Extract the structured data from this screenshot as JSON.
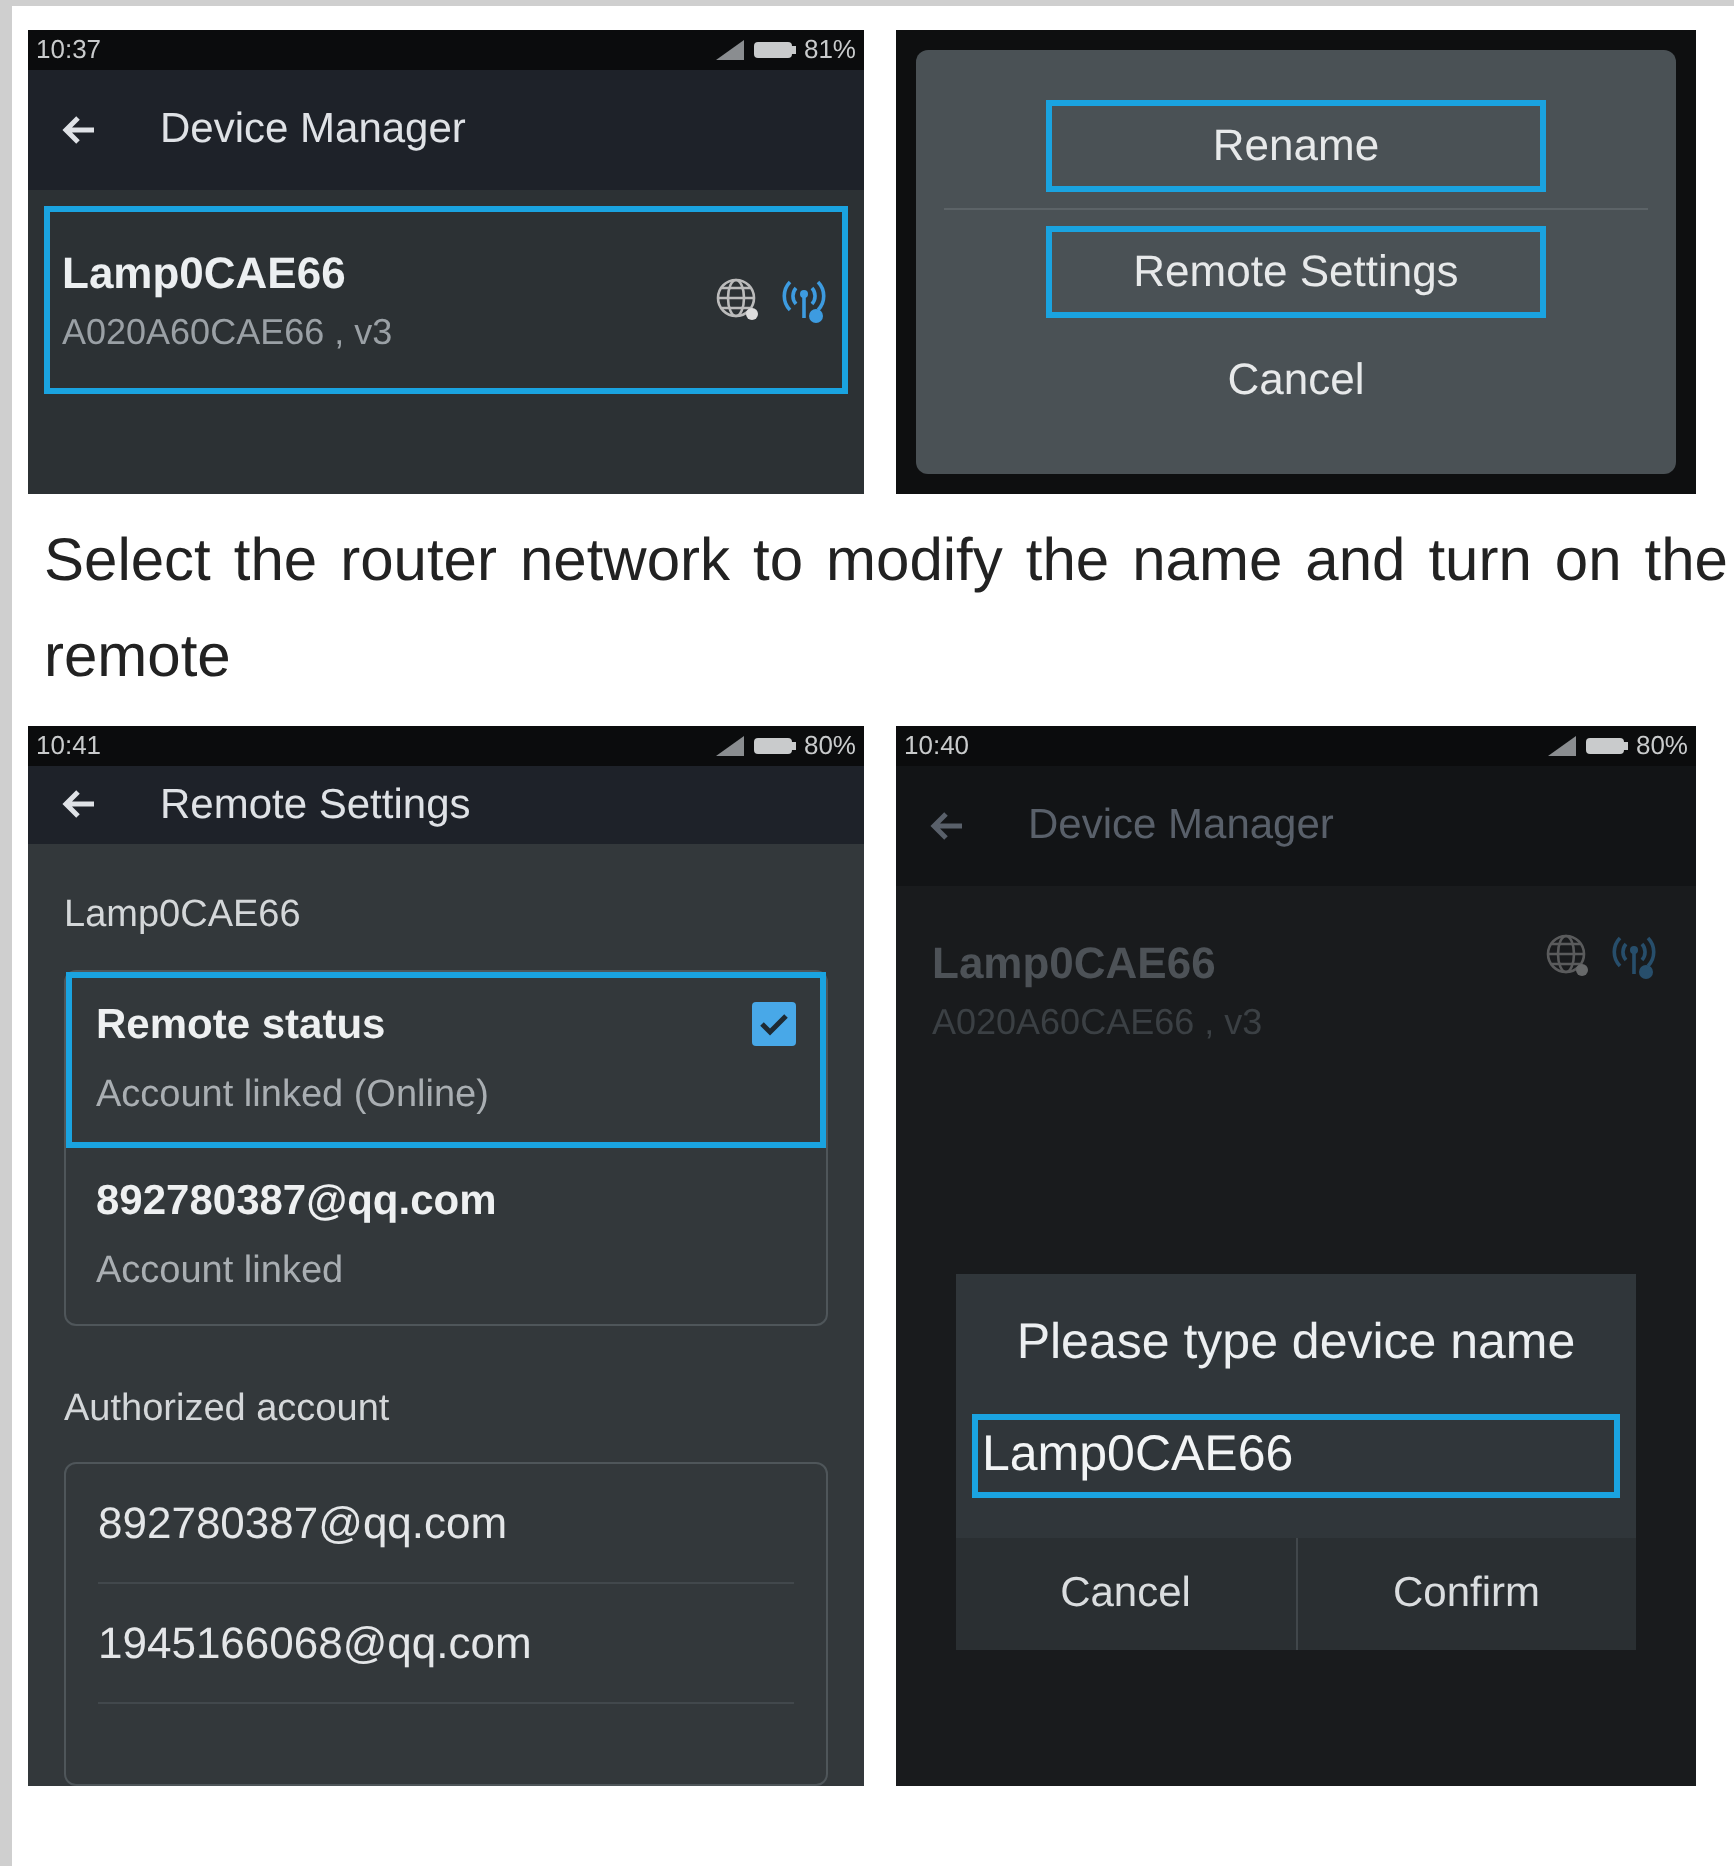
{
  "device_list_screen": {
    "status_bar": {
      "time": "10:37",
      "battery": "81%"
    },
    "header": {
      "title": "Device Manager"
    },
    "devices": [
      {
        "name": "Lamp0CAE66",
        "detail": "A020A60CAE66 , v3",
        "highlighted": true
      }
    ]
  },
  "action_menu": {
    "options": [
      {
        "label": "Rename",
        "highlighted": true
      },
      {
        "label": "Remote Settings",
        "highlighted": true
      },
      {
        "label": "Cancel",
        "highlighted": false
      }
    ]
  },
  "caption": "Select the router network to modify the name and turn on the remote",
  "remote_settings_screen": {
    "status_bar": {
      "time": "10:41",
      "battery": "80%"
    },
    "header": {
      "title": "Remote Settings"
    },
    "device_label": "Lamp0CAE66",
    "status_rows": [
      {
        "title": "Remote status",
        "subtitle": "Account linked (Online)",
        "checked": true,
        "highlighted": true
      },
      {
        "title": "892780387@qq.com",
        "subtitle": "Account linked",
        "highlighted": false
      }
    ],
    "authorized_label": "Authorized account",
    "accounts": [
      "892780387@qq.com",
      "1945166068@qq.com"
    ]
  },
  "rename_screen": {
    "status_bar": {
      "time": "10:40",
      "battery": "80%"
    },
    "header": {
      "title": "Device Manager"
    },
    "devices": [
      {
        "name": "Lamp0CAE66",
        "detail": "A020A60CAE66 , v3"
      }
    ],
    "dialog": {
      "title": "Please type device name",
      "value": "Lamp0CAE66",
      "highlighted": true,
      "buttons": [
        "Cancel",
        "Confirm"
      ]
    }
  }
}
